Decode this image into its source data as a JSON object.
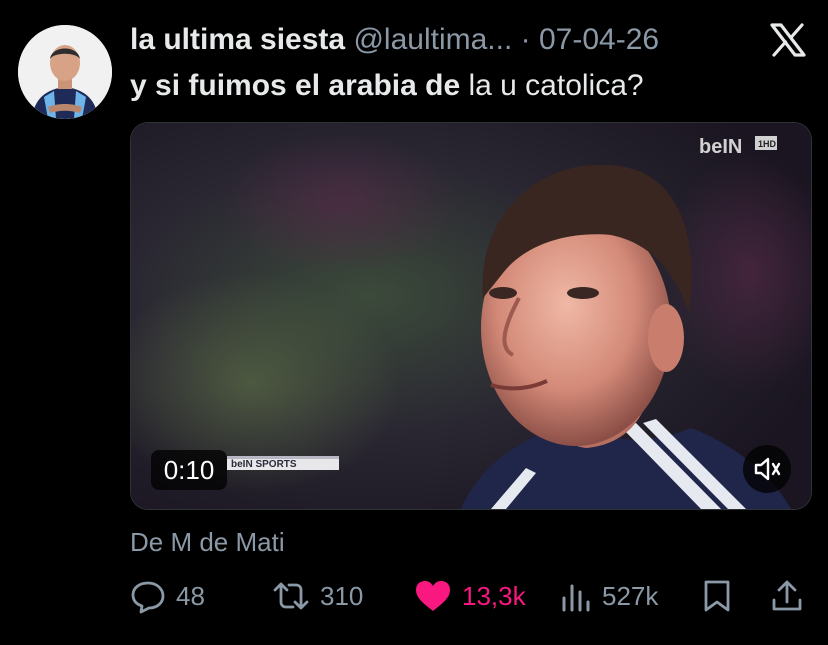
{
  "post": {
    "author_name": "la ultima siesta",
    "author_handle": "@laultima...",
    "separator": "·",
    "date": "07-04-26",
    "text_bold": "y si fuimos el arabia de",
    "text_rest": " la u catolica?",
    "source": "De M de Mati"
  },
  "video": {
    "duration": "0:10",
    "channel_bug": "beIN",
    "ticker": "beIN SPORTS"
  },
  "actions": {
    "replies": "48",
    "reposts": "310",
    "likes": "13,3k",
    "views": "527k"
  },
  "colors": {
    "background": "#000000",
    "text": "#e7e9ea",
    "muted": "#8b98a5",
    "like": "#f91880"
  },
  "icons": [
    "x-logo-icon",
    "speaker-icon",
    "reply-icon",
    "repost-icon",
    "heart-icon",
    "views-icon",
    "bookmark-icon",
    "share-icon"
  ]
}
